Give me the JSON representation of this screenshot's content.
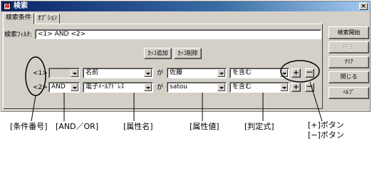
{
  "window": {
    "title": "検索",
    "icon_glyph": "検",
    "close_glyph": "×"
  },
  "tabs": [
    {
      "label": "検索条件",
      "active": true
    },
    {
      "label": "ｵﾌﾟｼｮﾝ",
      "active": false
    }
  ],
  "filter": {
    "label": "検索ﾌｨﾙﾀ:",
    "value": "<1> AND <2>"
  },
  "paren_buttons": {
    "add": "ｶｯｺ追加",
    "remove": "ｶｯｺ削除"
  },
  "rows": [
    {
      "number": "<1>",
      "andor": "",
      "attribute": "名前",
      "ga": "が",
      "value": "佐藤",
      "operator": "を含む",
      "plus": "+",
      "minus": "－"
    },
    {
      "number": "<2>",
      "andor": "AND",
      "attribute": "電子ﾒｰﾙｱﾄﾞﾚｽ",
      "ga": "が",
      "value": "satou",
      "operator": "を含む",
      "plus": "+",
      "minus": "－"
    }
  ],
  "side_buttons": {
    "search_start": "検索開始",
    "stop": "中止",
    "clear": "ｸﾘｱ",
    "close": "閉じる",
    "help": "ﾍﾙﾌﾟ"
  },
  "captions": {
    "condition_number": "[条件番号]",
    "and_or": "[AND／OR]",
    "attribute_name": "[属性名]",
    "attribute_value": "[属性値]",
    "operator": "[判定式]",
    "plus_button": "[+]ボタン",
    "minus_button": "[−]ボタン"
  }
}
